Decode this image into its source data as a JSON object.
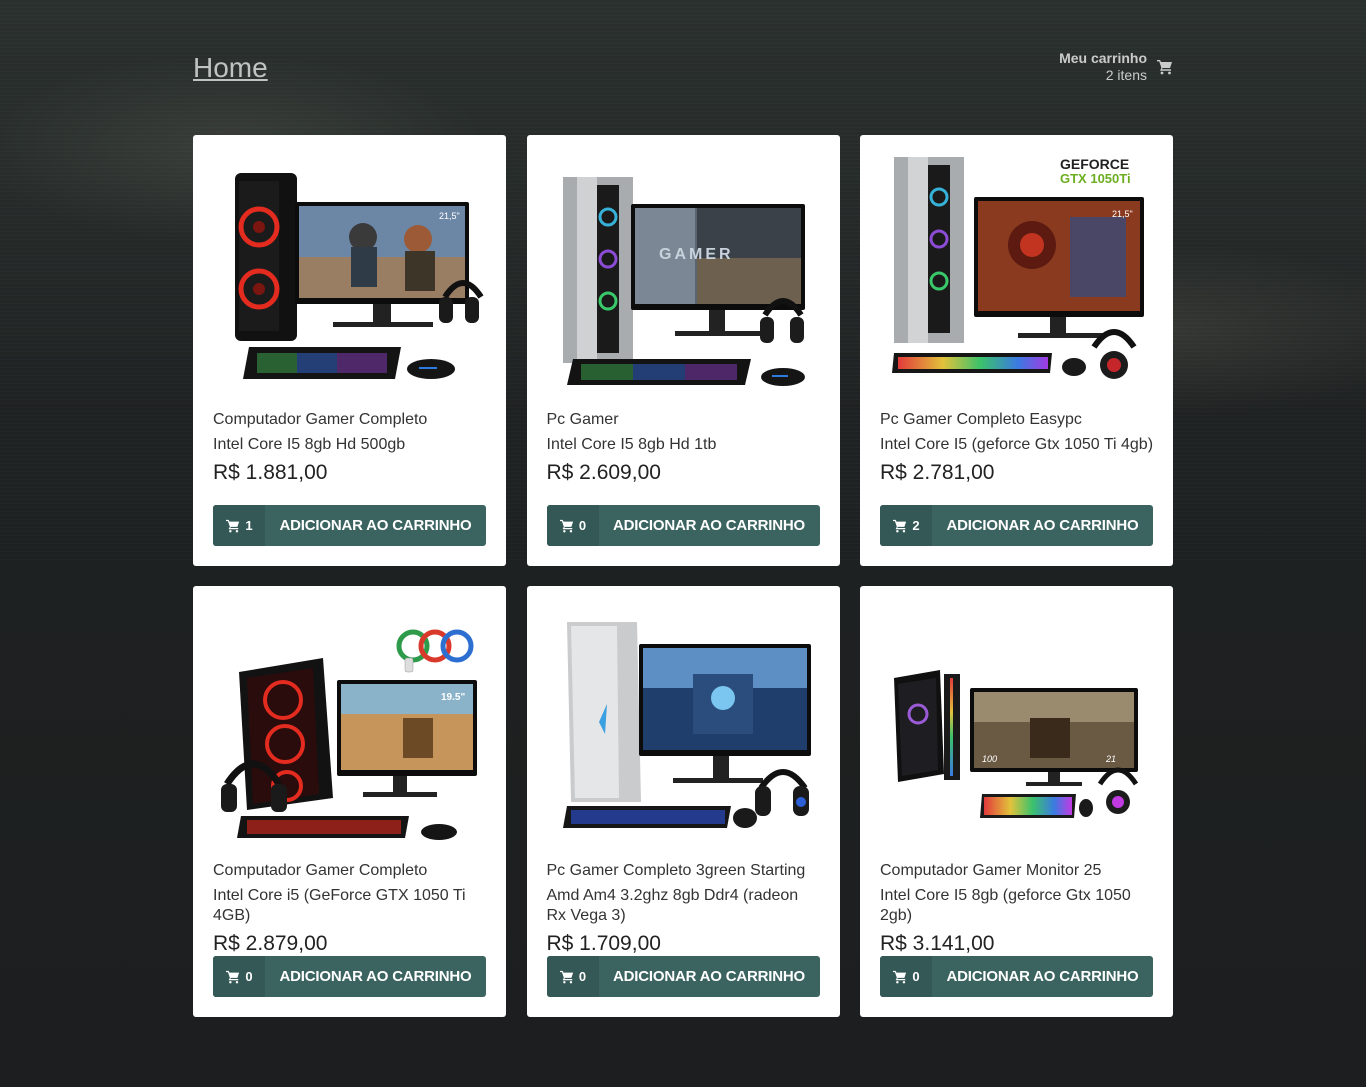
{
  "header": {
    "home_label": "Home",
    "cart_title": "Meu carrinho",
    "cart_count": "2 itens"
  },
  "products": [
    {
      "line1": "Computador Gamer Completo",
      "line2": "Intel Core I5 8gb Hd 500gb",
      "price": "R$ 1.881,00",
      "qty": "1",
      "button": "ADICIONAR AO CARRINHO",
      "monitor_size": "21,5\""
    },
    {
      "line1": "Pc Gamer",
      "line2": "Intel Core I5 8gb Hd 1tb",
      "price": "R$ 2.609,00",
      "qty": "0",
      "button": "ADICIONAR AO CARRINHO",
      "screen_text": "GAMER"
    },
    {
      "line1": "Pc Gamer Completo Easypc",
      "line2": "Intel Core I5 (geforce Gtx 1050 Ti 4gb)",
      "price": "R$ 2.781,00",
      "qty": "2",
      "button": "ADICIONAR AO CARRINHO",
      "badge_line1": "GEFORCE",
      "badge_line2": "GTX 1050Ti",
      "monitor_size": "21,5\""
    },
    {
      "line1": "Computador Gamer Completo",
      "line2": "Intel Core i5 (GeForce GTX 1050 Ti 4GB)",
      "price": "R$ 2.879,00",
      "qty": "0",
      "button": "ADICIONAR AO CARRINHO",
      "monitor_size": "19.5\""
    },
    {
      "line1": "Pc Gamer Completo 3green Starting",
      "line2": "Amd Am4 3.2ghz 8gb Ddr4 (radeon Rx Vega 3)",
      "price": "R$ 1.709,00",
      "qty": "0",
      "button": "ADICIONAR AO CARRINHO"
    },
    {
      "line1": "Computador Gamer Monitor 25",
      "line2": "Intel Core I5 8gb (geforce Gtx 1050 2gb)",
      "price": "R$ 3.141,00",
      "qty": "0",
      "button": "ADICIONAR AO CARRINHO",
      "hud_left": "100",
      "hud_right": "21"
    }
  ],
  "colors": {
    "button": "#3b6461",
    "button_count": "#335855",
    "card": "#ffffff"
  }
}
